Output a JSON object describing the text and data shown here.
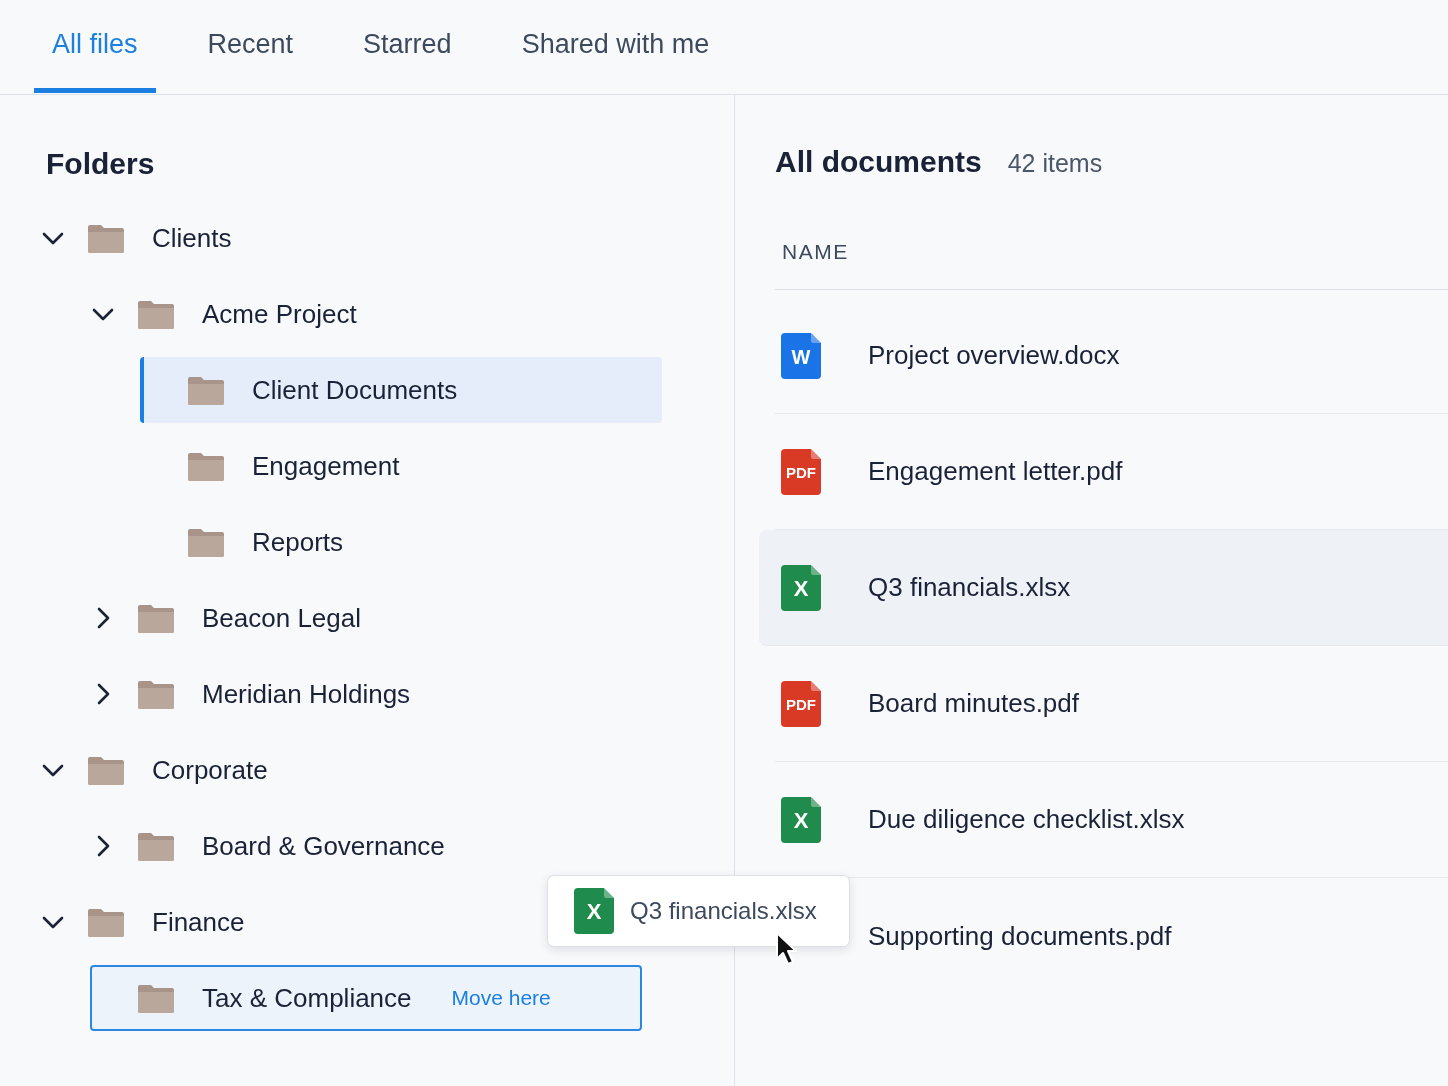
{
  "tabs": [
    {
      "label": "All files",
      "selected": true
    },
    {
      "label": "Recent",
      "selected": false
    },
    {
      "label": "Starred",
      "selected": false
    },
    {
      "label": "Shared with me",
      "selected": false
    }
  ],
  "folders": {
    "title": "Folders",
    "items": [
      {
        "label": "Clients",
        "expanded": true,
        "selected": false,
        "children": [
          {
            "label": "Acme Project",
            "expanded": true,
            "selected": false,
            "children": [
              {
                "label": "Client Documents",
                "selected": true
              },
              {
                "label": "Engagement",
                "selected": false
              },
              {
                "label": "Reports",
                "selected": false
              }
            ]
          },
          {
            "label": "Beacon Legal",
            "expanded": false,
            "selected": false
          },
          {
            "label": "Meridian Holdings",
            "expanded": false,
            "selected": false
          }
        ]
      },
      {
        "label": "Corporate",
        "expanded": true,
        "selected": false,
        "children": [
          {
            "label": "Board & Governance",
            "expanded": false,
            "selected": false
          }
        ]
      },
      {
        "label": "Finance",
        "expanded": true,
        "selected": false,
        "children": [
          {
            "label": "Tax & Compliance",
            "selected": false,
            "drop_target": true,
            "action": "Move here"
          }
        ]
      }
    ]
  },
  "documents": {
    "title": "All documents",
    "count": "42 items",
    "column": "NAME",
    "files": [
      {
        "name": "Project overview.docx",
        "kind": "word",
        "icon_text": "W",
        "dragging": false
      },
      {
        "name": "Engagement letter.pdf",
        "kind": "pdf",
        "icon_text": "PDF",
        "dragging": false
      },
      {
        "name": "Q3 financials.xlsx",
        "kind": "excel",
        "icon_text": "X",
        "dragging": true
      },
      {
        "name": "Board minutes.pdf",
        "kind": "pdf",
        "icon_text": "PDF",
        "dragging": false
      },
      {
        "name": "Due diligence checklist.xlsx",
        "kind": "excel",
        "icon_text": "X",
        "dragging": false
      },
      {
        "name": "Supporting documents.pdf",
        "dragging": false
      }
    ]
  },
  "drag_preview": {
    "name": "Q3 financials.xlsx",
    "kind": "excel",
    "icon_text": "X"
  }
}
